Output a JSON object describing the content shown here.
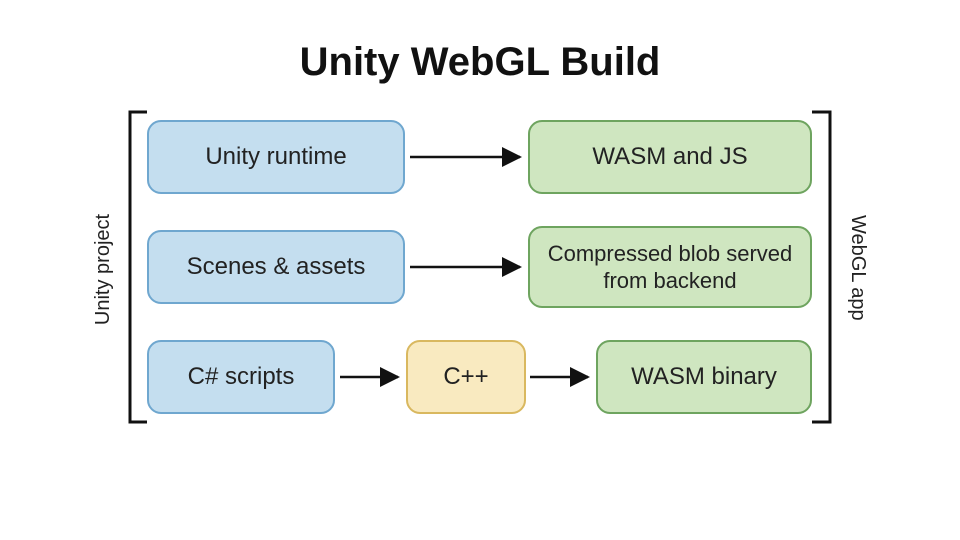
{
  "title": "Unity WebGL Build",
  "left_label": "Unity project",
  "right_label": "WebGL app",
  "boxes": {
    "unity_runtime": "Unity runtime",
    "scenes_assets": "Scenes & assets",
    "csharp_scripts": "C# scripts",
    "wasm_js": "WASM and JS",
    "compressed_blob": "Compressed blob served from backend",
    "cpp": "C++",
    "wasm_binary": "WASM binary"
  },
  "arrows": [
    {
      "from": "unity_runtime",
      "to": "wasm_js"
    },
    {
      "from": "scenes_assets",
      "to": "compressed_blob"
    },
    {
      "from": "csharp_scripts",
      "to": "cpp"
    },
    {
      "from": "cpp",
      "to": "wasm_binary"
    }
  ],
  "groups": {
    "left_bracket_items": [
      "unity_runtime",
      "scenes_assets",
      "csharp_scripts"
    ],
    "right_bracket_items": [
      "wasm_js",
      "compressed_blob",
      "wasm_binary"
    ]
  }
}
